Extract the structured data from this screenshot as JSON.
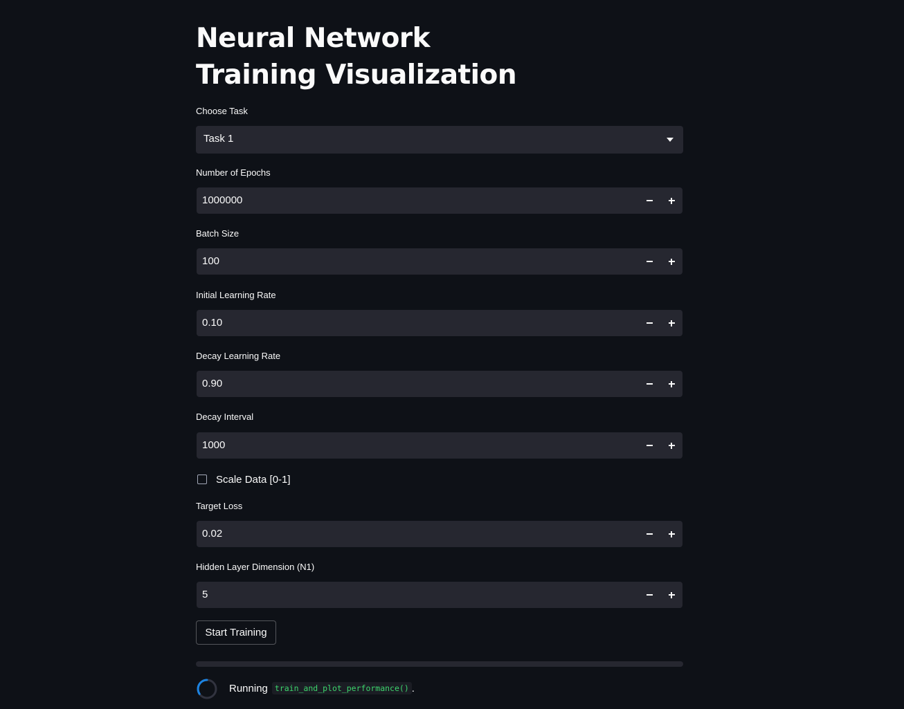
{
  "page": {
    "title": "Neural Network Training Visualization"
  },
  "task_select": {
    "label": "Choose Task",
    "value": "Task 1"
  },
  "fields": [
    {
      "label": "Number of Epochs",
      "value": "1000000"
    },
    {
      "label": "Batch Size",
      "value": "100"
    },
    {
      "label": "Initial Learning Rate",
      "value": "0.10"
    },
    {
      "label": "Decay Learning Rate",
      "value": "0.90"
    },
    {
      "label": "Decay Interval",
      "value": "1000"
    }
  ],
  "scale_checkbox": {
    "label": "Scale Data [0-1]",
    "checked": false
  },
  "fields2": [
    {
      "label": "Target Loss",
      "value": "0.02"
    },
    {
      "label": "Hidden Layer Dimension (N1)",
      "value": "5"
    }
  ],
  "start_button": {
    "label": "Start Training"
  },
  "progress": {
    "value": 0
  },
  "status": {
    "prefix": "Running",
    "code": "train_and_plot_performance()",
    "suffix": "."
  },
  "colors": {
    "background": "#0e1117",
    "input_bg": "#262730",
    "text": "#fafafa",
    "code_text": "#3dd56d",
    "spinner_accent": "#1c83e1"
  }
}
